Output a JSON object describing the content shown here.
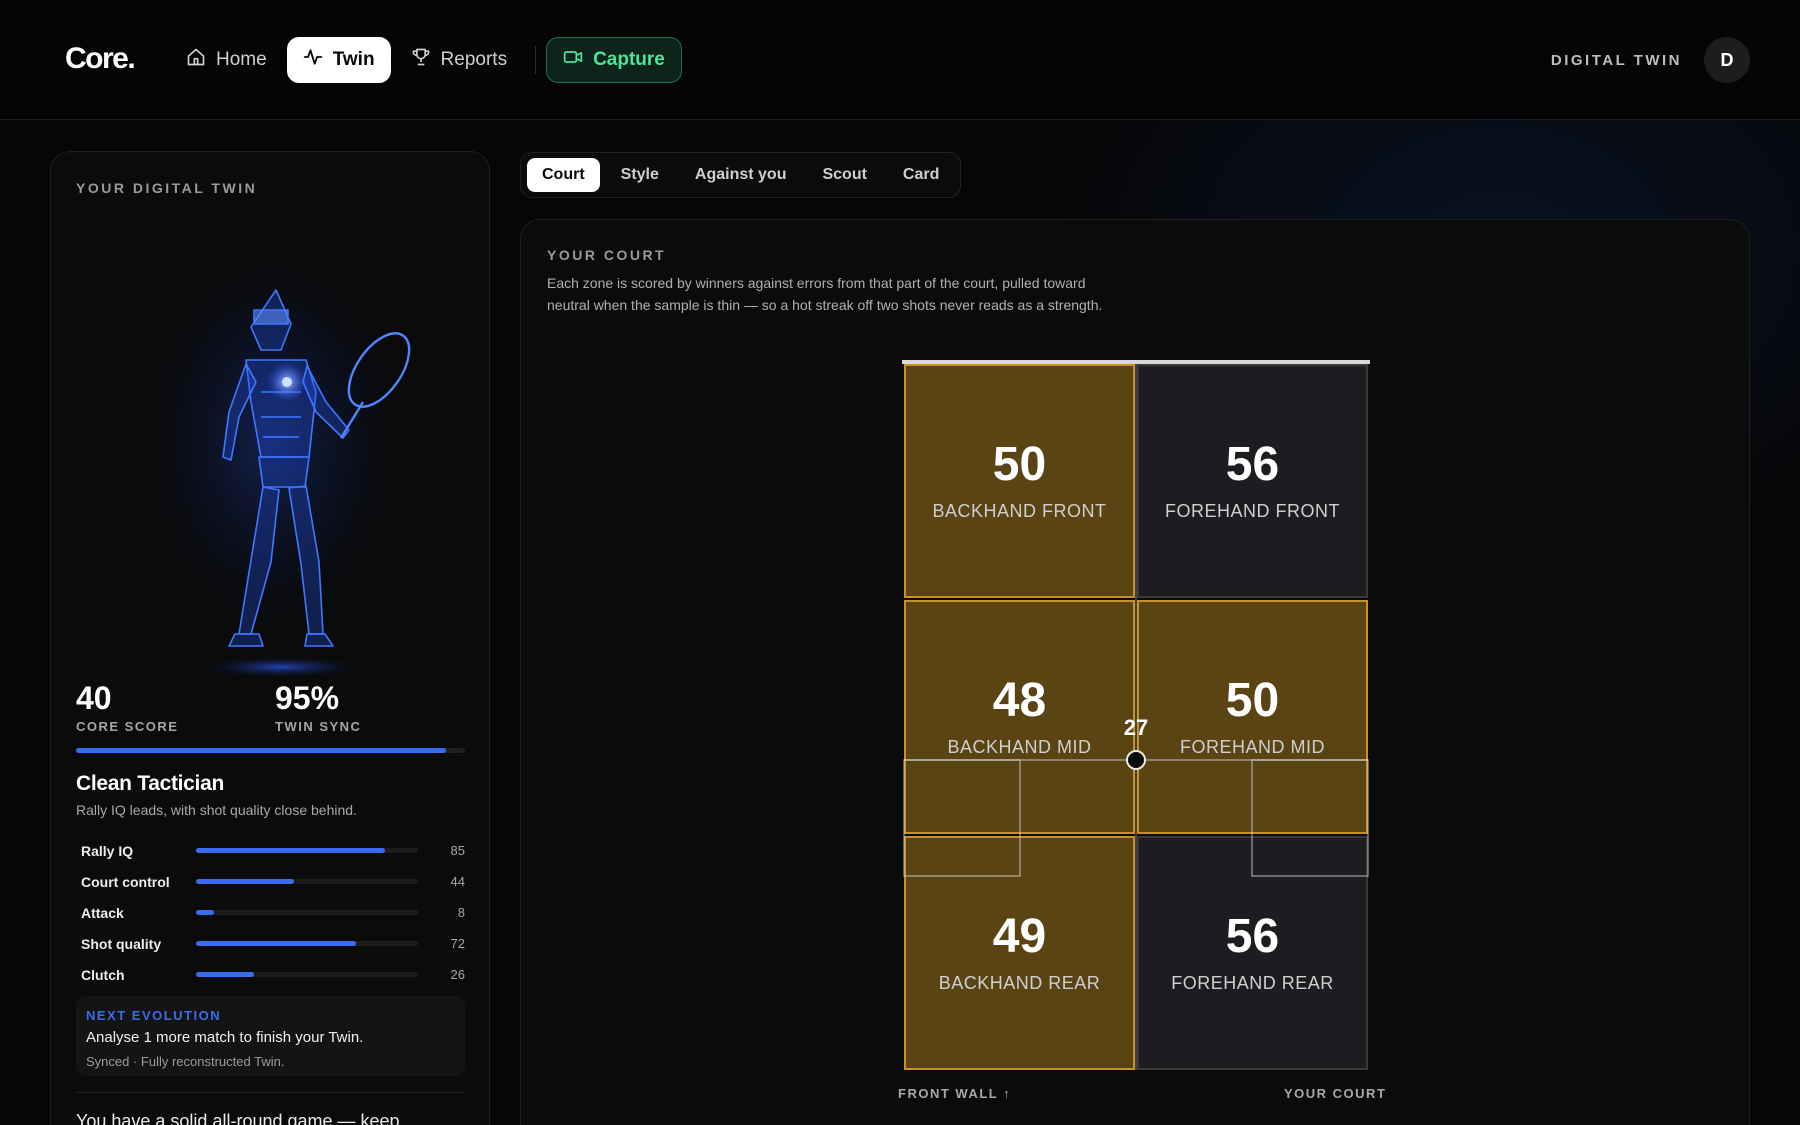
{
  "brand": {
    "logo": "Core."
  },
  "nav": {
    "items": [
      {
        "label": "Home",
        "icon": "home-icon"
      },
      {
        "label": "Twin",
        "icon": "pulse-icon",
        "active": true
      },
      {
        "label": "Reports",
        "icon": "trophy-icon"
      }
    ],
    "capture_label": "Capture"
  },
  "header": {
    "right_label": "DIGITAL TWIN",
    "avatar_initial": "D"
  },
  "twin": {
    "section_title": "YOUR DIGITAL TWIN",
    "core_score": "40",
    "core_score_label": "CORE SCORE",
    "twin_sync": "95%",
    "twin_sync_label": "TWIN SYNC",
    "twin_sync_fraction": 0.95,
    "archetype": "Clean Tactician",
    "archetype_sub": "Rally IQ leads, with shot quality close behind.",
    "attributes": [
      {
        "name": "Rally IQ",
        "value": 85
      },
      {
        "name": "Court control",
        "value": 44
      },
      {
        "name": "Attack",
        "value": 8
      },
      {
        "name": "Shot quality",
        "value": 72
      },
      {
        "name": "Clutch",
        "value": 26
      }
    ],
    "next_evolution": {
      "title": "NEXT EVOLUTION",
      "message": "Analyse 1 more match to finish your Twin.",
      "status": "Synced · Fully reconstructed Twin."
    },
    "summary": "You have a solid all-round game — keep"
  },
  "tabs": [
    "Court",
    "Style",
    "Against you",
    "Scout",
    "Card"
  ],
  "active_tab": "Court",
  "court": {
    "title": "YOUR COURT",
    "description": "Each zone is scored by winners against errors from that part of the court, pulled toward neutral when the sample is thin — so a hot streak off two shots never reads as a strength.",
    "zones": [
      {
        "score": "50",
        "name": "BACKHAND FRONT",
        "strong": true
      },
      {
        "score": "56",
        "name": "FOREHAND FRONT",
        "strong": false
      },
      {
        "score": "48",
        "name": "BACKHAND MID",
        "strong": true
      },
      {
        "score": "50",
        "name": "FOREHAND MID",
        "strong": true
      },
      {
        "score": "49",
        "name": "BACKHAND REAR",
        "strong": true
      },
      {
        "score": "56",
        "name": "FOREHAND REAR",
        "strong": false
      }
    ],
    "position_marker": "27",
    "front_wall_label": "FRONT WALL ↑",
    "your_court_label": "YOUR COURT",
    "colors": {
      "strong_fill": "#5a4414",
      "strong_border": "#c69228",
      "neutral_fill": "#1c1d20",
      "accent_blue": "#3b6cf0",
      "capture_green": "#4ee39b"
    }
  }
}
